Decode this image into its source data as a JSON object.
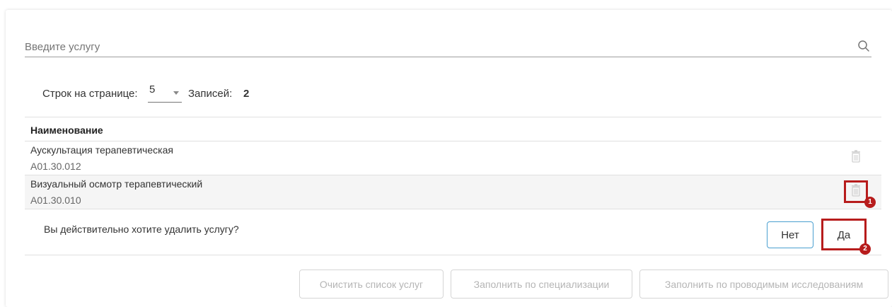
{
  "search": {
    "placeholder": "Введите услугу",
    "icon": "search-icon"
  },
  "pager": {
    "rows_per_page_label": "Строк на странице:",
    "rows_per_page_value": "5",
    "records_label": "Записей:",
    "records_count": "2"
  },
  "table": {
    "column_header": "Наименование",
    "rows": [
      {
        "name": "Аускультация терапевтическая",
        "code": "A01.30.012"
      },
      {
        "name": "Визуальный осмотр терапевтический",
        "code": "A01.30.010"
      }
    ]
  },
  "confirm": {
    "question": "Вы действительно хотите удалить услугу?",
    "no_label": "Нет",
    "yes_label": "Да"
  },
  "annotations": {
    "badge_1": "1",
    "badge_2": "2",
    "highlight_color": "#b71c1c"
  },
  "bottom_buttons": {
    "clear": "Очистить список услуг",
    "fill_by_specialization": "Заполнить по специализации",
    "fill_by_research": "Заполнить по проводимым исследованиям"
  },
  "colors": {
    "accent_border": "#4a9fd0",
    "disabled_text": "#b5b5b5"
  }
}
